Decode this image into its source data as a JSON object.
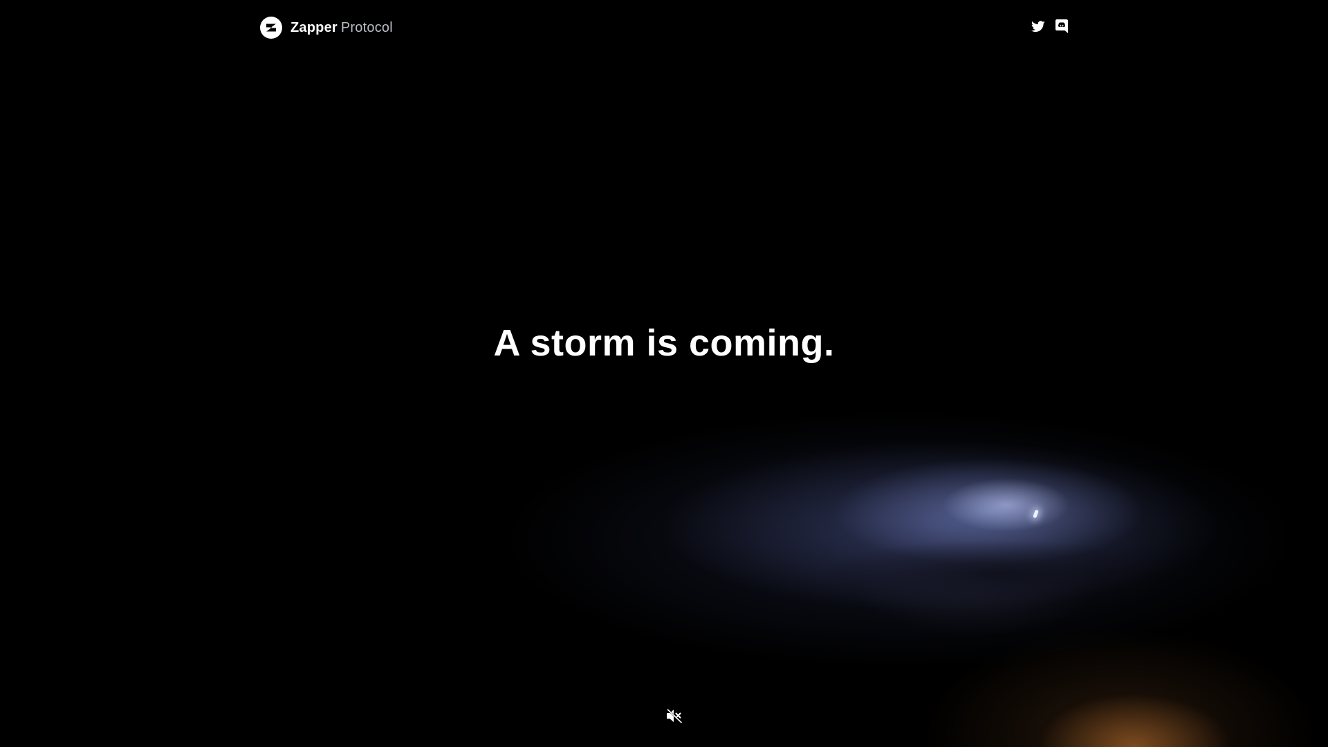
{
  "header": {
    "brand_name": "Zapper",
    "brand_suffix": "Protocol",
    "logo_icon": "zapper-logo-icon",
    "social_links": [
      {
        "icon": "twitter-icon"
      },
      {
        "icon": "discord-icon"
      }
    ]
  },
  "hero": {
    "headline": "A storm is coming."
  },
  "video_controls": {
    "mute_icon": "speaker-muted-icon"
  },
  "colors": {
    "background": "#000000",
    "text_primary": "#ffffff",
    "text_secondary": "#b9bcc6"
  }
}
